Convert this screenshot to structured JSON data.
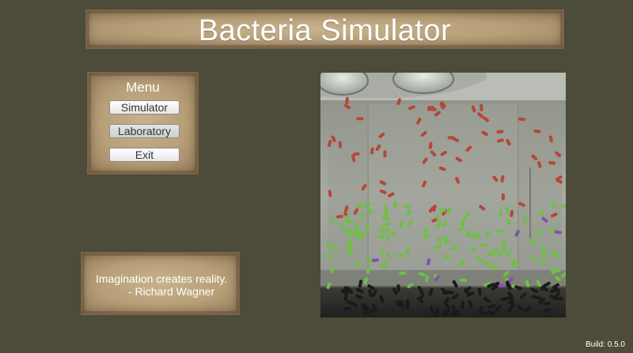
{
  "app": {
    "title": "Bacteria Simulator",
    "build": "Build: 0.5.0"
  },
  "menu": {
    "title": "Menu",
    "items": [
      {
        "label": "Simulator",
        "selected": false
      },
      {
        "label": "Laboratory",
        "selected": true
      },
      {
        "label": "Exit",
        "selected": false
      }
    ]
  },
  "quote": {
    "text": "Imagination creates reality.",
    "author": "- Richard Wagner"
  },
  "simulation_view": {
    "scene": "laboratory-tank",
    "bacteria_colors": {
      "red": "#b5473a",
      "green": "#6fbf45",
      "purple": "#8a4bb4",
      "dark": "#1a1a18"
    }
  },
  "colors": {
    "background": "#4d4b39",
    "parchment": "#bba27a",
    "text": "#ffffff"
  }
}
